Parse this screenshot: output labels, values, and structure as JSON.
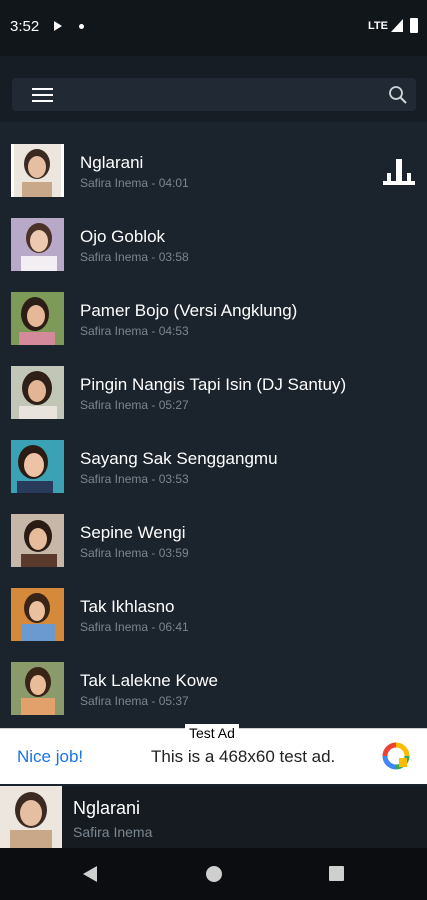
{
  "status_bar": {
    "time": "3:52",
    "network": "LTE"
  },
  "header": {
    "menu_icon": "menu-icon",
    "search_icon": "search-icon"
  },
  "songs": [
    {
      "title": "Nglarani",
      "artist": "Safira Inema",
      "duration": "04:01",
      "subtitle": "Safira Inema - 04:01",
      "playing": true
    },
    {
      "title": "Ojo Goblok",
      "artist": "Safira Inema",
      "duration": "03:58",
      "subtitle": "Safira Inema - 03:58"
    },
    {
      "title": "Pamer Bojo (Versi Angklung)",
      "artist": "Safira Inema",
      "duration": "04:53",
      "subtitle": "Safira Inema - 04:53"
    },
    {
      "title": "Pingin Nangis Tapi Isin (DJ Santuy)",
      "artist": "Safira Inema",
      "duration": "05:27",
      "subtitle": "Safira Inema - 05:27"
    },
    {
      "title": "Sayang Sak Senggangmu",
      "artist": "Safira Inema",
      "duration": "03:53",
      "subtitle": "Safira Inema - 03:53"
    },
    {
      "title": "Sepine Wengi",
      "artist": "Safira Inema",
      "duration": "03:59",
      "subtitle": "Safira Inema - 03:59"
    },
    {
      "title": "Tak Ikhlasno",
      "artist": "Safira Inema",
      "duration": "06:41",
      "subtitle": "Safira Inema - 06:41"
    },
    {
      "title": "Tak Lalekne Kowe",
      "artist": "Safira Inema",
      "duration": "05:37",
      "subtitle": "Safira Inema - 05:37"
    }
  ],
  "ad": {
    "label": "Test Ad",
    "cta": "Nice job!",
    "text": "This is a 468x60 test ad."
  },
  "now_playing": {
    "title": "Nglarani",
    "artist": "Safira Inema"
  },
  "colors": {
    "background": "#1b232c",
    "header": "#161d24",
    "subtitle": "#7c8690",
    "ad_cta": "#1a73e8"
  }
}
